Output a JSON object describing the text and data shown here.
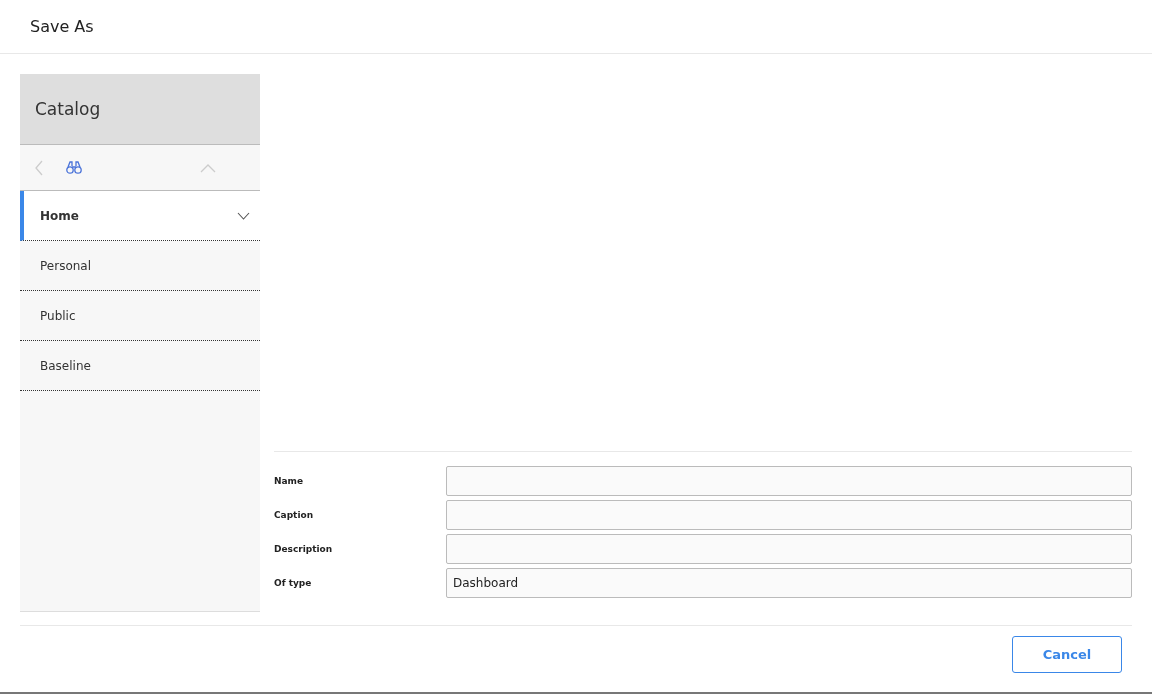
{
  "window": {
    "title": "Save As"
  },
  "catalog": {
    "title": "Catalog",
    "items": [
      {
        "label": "Home",
        "selected": true,
        "expanded": true
      },
      {
        "label": "Personal",
        "selected": false,
        "expanded": false
      },
      {
        "label": "Public",
        "selected": false,
        "expanded": false
      },
      {
        "label": "Baseline",
        "selected": false,
        "expanded": false
      }
    ]
  },
  "form": {
    "fields": [
      {
        "label": "Name"
      },
      {
        "label": "Caption"
      },
      {
        "label": "Description"
      },
      {
        "label": "Of type",
        "value": "Dashboard"
      }
    ]
  },
  "buttons": [
    "Cancel"
  ]
}
